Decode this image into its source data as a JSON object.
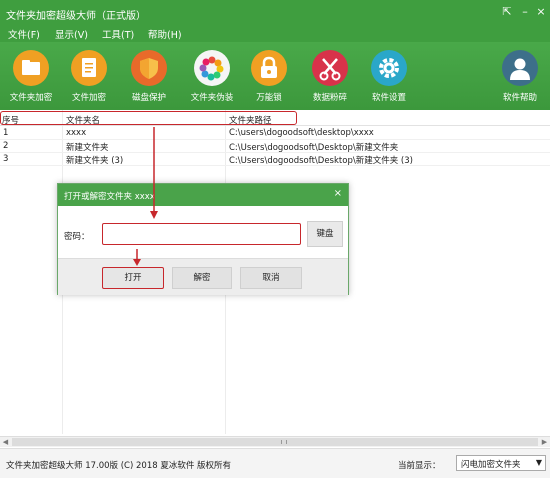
{
  "window": {
    "title": "文件夹加密超级大师（正式版）"
  },
  "menu": [
    "文件(F)",
    "显示(V)",
    "工具(T)",
    "帮助(H)"
  ],
  "toolbar": [
    {
      "label": "文件夹加密",
      "icon": "folder-icon",
      "color": "#f0a023"
    },
    {
      "label": "文件加密",
      "icon": "document-icon",
      "color": "#f0a023"
    },
    {
      "label": "磁盘保护",
      "icon": "shield-icon",
      "color": "#e86a2a"
    },
    {
      "label": "文件夹伪装",
      "icon": "color-wheel-icon",
      "color": "#f5f5f5"
    },
    {
      "label": "万能锁",
      "icon": "padlock-icon",
      "color": "#f0a023"
    },
    {
      "label": "数据粉碎",
      "icon": "scissors-icon",
      "color": "#d8324a"
    },
    {
      "label": "软件设置",
      "icon": "gear-icon",
      "color": "#2aa7c9"
    },
    {
      "label": "软件帮助",
      "icon": "user-icon",
      "color": "#3d6f8a"
    }
  ],
  "table": {
    "headers": [
      "序号",
      "文件夹名",
      "文件夹路径"
    ],
    "rows": [
      [
        "1",
        "xxxx",
        "C:\\users\\dogoodsoft\\desktop\\xxxx"
      ],
      [
        "2",
        "新建文件夹",
        "C:\\Users\\dogoodsoft\\Desktop\\新建文件夹"
      ],
      [
        "3",
        "新建文件夹 (3)",
        "C:\\Users\\dogoodsoft\\Desktop\\新建文件夹 (3)"
      ]
    ]
  },
  "dialog": {
    "title": "打开或解密文件夹 xxxx",
    "password_label": "密码：",
    "password_value": "",
    "keyboard_label": "键盘",
    "open_label": "打开",
    "decrypt_label": "解密",
    "cancel_label": "取消"
  },
  "status": {
    "left": "文件夹加密超级大师 17.00版 (C) 2018 夏冰软件 版权所有",
    "display_label": "当前显示：",
    "display_value": "闪电加密文件夹"
  },
  "colors": {
    "theme_green": "#3f9e3f",
    "highlight_red": "#c7272c"
  }
}
